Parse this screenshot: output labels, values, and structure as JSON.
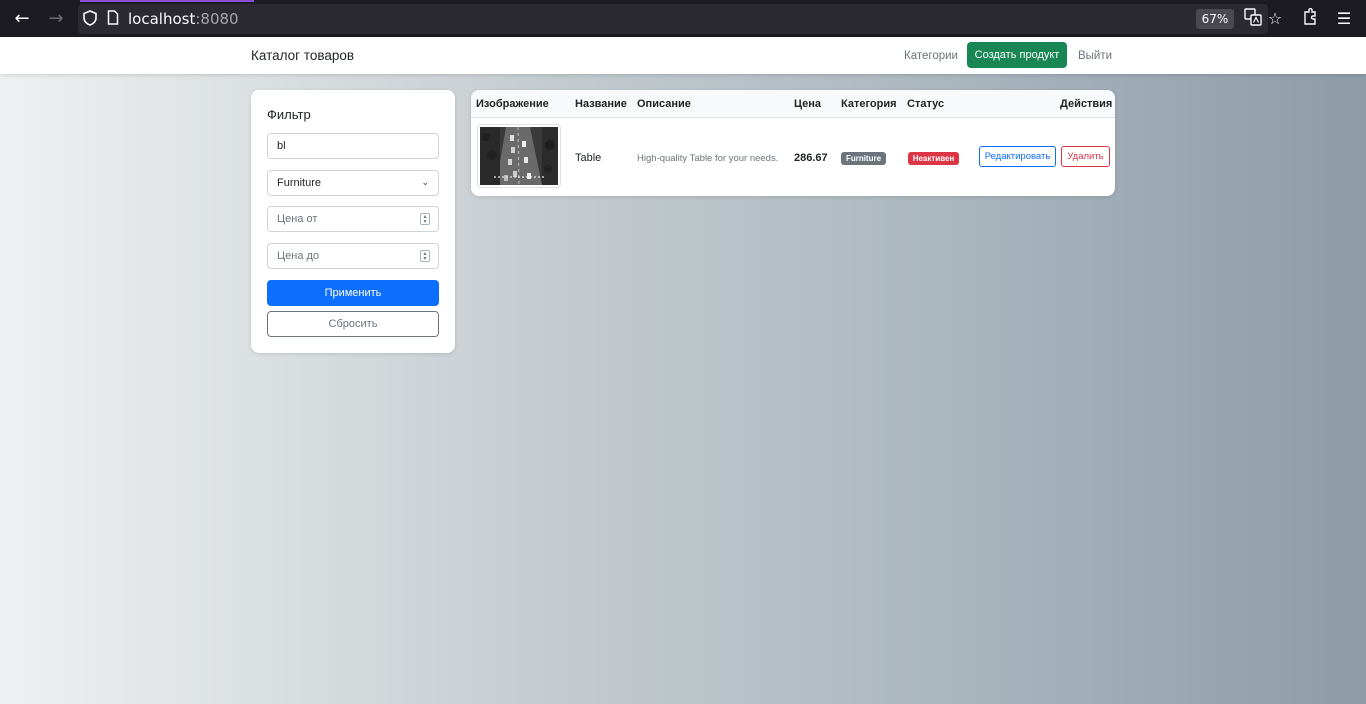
{
  "browser": {
    "url_host": "localhost",
    "url_port": ":8080",
    "zoom": "67%",
    "icons": [
      "back-arrow-icon",
      "forward-arrow-icon",
      "shield-icon",
      "page-icon",
      "translate-icon",
      "star-icon",
      "extensions-icon",
      "menu-icon"
    ]
  },
  "navbar": {
    "brand": "Каталог товаров",
    "categories_link": "Категории",
    "create_button": "Создать продукт",
    "logout_link": "Выйти"
  },
  "filter": {
    "title": "Фильтр",
    "search_value": "bl",
    "category_selected": "Furniture",
    "price_from_placeholder": "Цена от",
    "price_to_placeholder": "Цена до",
    "apply_button": "Применить",
    "reset_button": "Сбросить"
  },
  "table": {
    "headers": {
      "image": "Изображение",
      "name": "Название",
      "description": "Описание",
      "price": "Цена",
      "category": "Категория",
      "status": "Статус",
      "actions": "Действия"
    },
    "rows": [
      {
        "name": "Table",
        "description": "High-quality Table for your needs.",
        "price": "286.67",
        "category": "Furniture",
        "status": "Неактивен",
        "edit_button": "Редактировать",
        "delete_button": "Удалить"
      }
    ]
  },
  "colors": {
    "primary": "#0d6efd",
    "success": "#198754",
    "danger": "#dc3545",
    "secondary": "#6c757d"
  }
}
